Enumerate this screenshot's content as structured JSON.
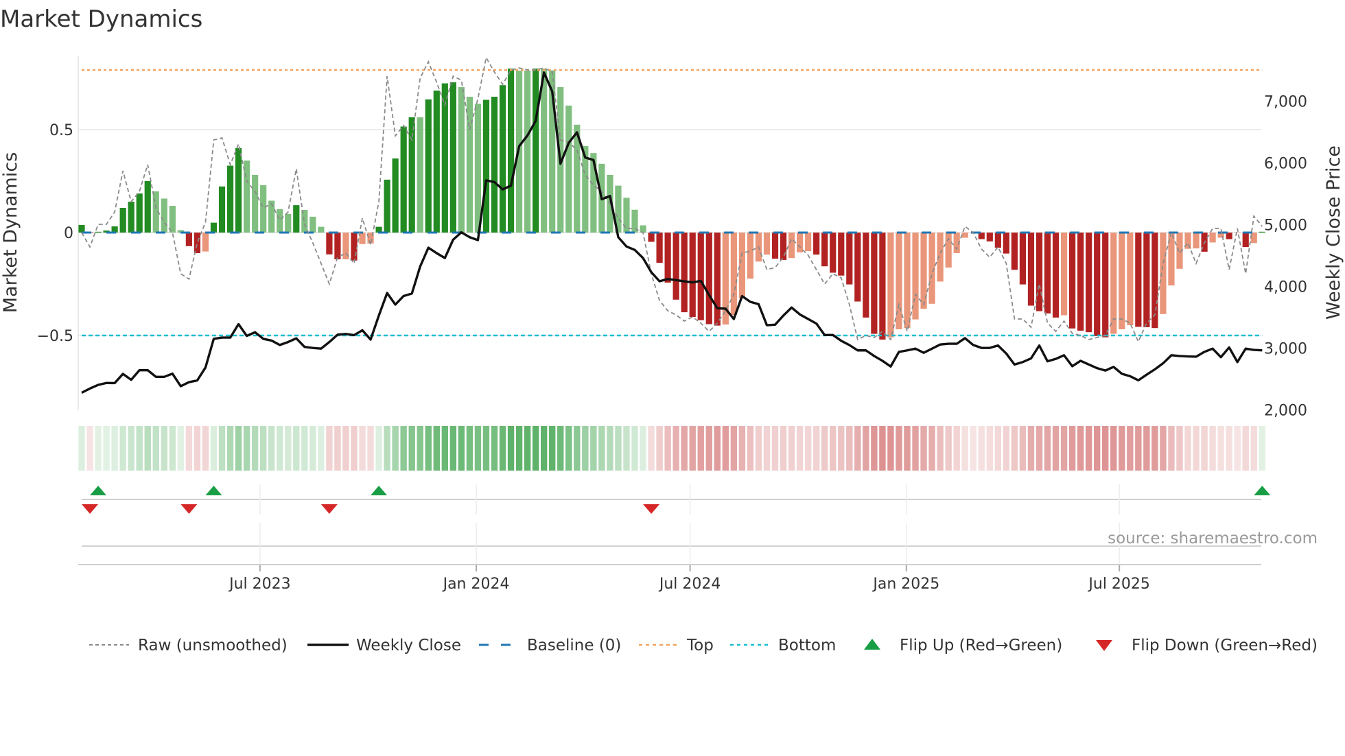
{
  "title": "Market Dynamics",
  "source": "source: sharemaestro.com",
  "chart_data": {
    "type": "bar",
    "title": "Market Dynamics",
    "left_axis": {
      "label": "Market Dynamics",
      "range": [
        -0.86,
        0.86
      ],
      "ticks": [
        {
          "v": 0.5,
          "label": "0.5"
        },
        {
          "v": 0,
          "label": "0"
        },
        {
          "v": -0.5,
          "label": "−0.5"
        }
      ]
    },
    "right_axis": {
      "label": "Weekly Close Price",
      "range": [
        2000,
        7740
      ],
      "ticks": [
        {
          "v": 2000,
          "label": "2,000"
        },
        {
          "v": 3000,
          "label": "3,000"
        },
        {
          "v": 4000,
          "label": "4,000"
        },
        {
          "v": 5000,
          "label": "5,000"
        },
        {
          "v": 6000,
          "label": "6,000"
        },
        {
          "v": 7000,
          "label": "7,000"
        }
      ]
    },
    "x_unit": "week index",
    "x_ticks": [
      {
        "week": 21.6,
        "label": "Jul 2023"
      },
      {
        "week": 47.8,
        "label": "Jan 2024"
      },
      {
        "week": 73.7,
        "label": "Jul 2024"
      },
      {
        "week": 99.9,
        "label": "Jan 2025"
      },
      {
        "week": 125.7,
        "label": "Jul 2025"
      }
    ],
    "baseline": 0,
    "top_level": 0.79,
    "bottom_level": -0.5,
    "dynamics": [
      0.037,
      -0.003,
      0.004,
      0.01,
      0.03,
      0.12,
      0.15,
      0.19,
      0.25,
      0.2,
      0.165,
      0.13,
      0.012,
      -0.066,
      -0.1,
      -0.092,
      0.048,
      0.224,
      0.325,
      0.41,
      0.35,
      0.28,
      0.23,
      0.155,
      0.114,
      0.09,
      0.133,
      0.11,
      0.077,
      0.028,
      -0.106,
      -0.13,
      -0.13,
      -0.136,
      -0.056,
      -0.053,
      0.028,
      0.257,
      0.36,
      0.515,
      0.56,
      0.56,
      0.647,
      0.69,
      0.725,
      0.73,
      0.707,
      0.66,
      0.626,
      0.645,
      0.66,
      0.716,
      0.797,
      0.787,
      0.787,
      0.797,
      0.797,
      0.788,
      0.707,
      0.617,
      0.524,
      0.42,
      0.386,
      0.334,
      0.28,
      0.228,
      0.169,
      0.111,
      0.035,
      -0.045,
      -0.147,
      -0.243,
      -0.326,
      -0.387,
      -0.41,
      -0.426,
      -0.445,
      -0.452,
      -0.447,
      -0.4,
      -0.32,
      -0.224,
      -0.141,
      -0.107,
      -0.127,
      -0.133,
      -0.124,
      -0.096,
      -0.09,
      -0.107,
      -0.164,
      -0.195,
      -0.209,
      -0.252,
      -0.335,
      -0.413,
      -0.492,
      -0.52,
      -0.509,
      -0.47,
      -0.464,
      -0.422,
      -0.37,
      -0.346,
      -0.238,
      -0.17,
      -0.1,
      -0.025,
      -0.002,
      -0.032,
      -0.043,
      -0.074,
      -0.102,
      -0.181,
      -0.252,
      -0.355,
      -0.382,
      -0.393,
      -0.413,
      -0.402,
      -0.466,
      -0.477,
      -0.484,
      -0.503,
      -0.509,
      -0.492,
      -0.47,
      -0.45,
      -0.458,
      -0.46,
      -0.464,
      -0.396,
      -0.257,
      -0.176,
      -0.079,
      -0.077,
      -0.093,
      -0.048,
      -0.025,
      -0.032,
      -0.002,
      -0.07,
      -0.051,
      0.004
    ],
    "raw": [
      0.0,
      -0.07,
      0.04,
      0.04,
      0.1,
      0.3,
      0.15,
      0.2,
      0.33,
      0.12,
      0.05,
      0.0,
      -0.2,
      -0.226,
      -0.05,
      0.05,
      0.45,
      0.46,
      0.33,
      0.43,
      0.25,
      0.2,
      0.12,
      0.14,
      0.06,
      0.1,
      0.31,
      0.04,
      -0.05,
      -0.15,
      -0.25,
      -0.12,
      -0.1,
      -0.15,
      0.07,
      -0.06,
      0.15,
      0.76,
      0.47,
      0.52,
      0.45,
      0.75,
      0.83,
      0.73,
      0.62,
      0.76,
      0.74,
      0.5,
      0.65,
      0.85,
      0.78,
      0.72,
      0.79,
      0.8,
      0.79,
      0.79,
      0.8,
      0.78,
      0.45,
      0.44,
      0.4,
      0.28,
      0.23,
      0.2,
      0.14,
      0.07,
      0.02,
      0.02,
      0.0,
      -0.2,
      -0.33,
      -0.38,
      -0.4,
      -0.43,
      -0.41,
      -0.44,
      -0.48,
      -0.44,
      -0.38,
      -0.3,
      -0.1,
      -0.09,
      -0.07,
      -0.18,
      -0.17,
      -0.12,
      -0.03,
      -0.07,
      -0.11,
      -0.18,
      -0.25,
      -0.2,
      -0.22,
      -0.35,
      -0.52,
      -0.5,
      -0.51,
      -0.48,
      -0.52,
      -0.35,
      -0.48,
      -0.3,
      -0.35,
      -0.2,
      -0.1,
      -0.03,
      -0.08,
      0.03,
      0.0,
      -0.08,
      -0.12,
      -0.07,
      -0.15,
      -0.42,
      -0.42,
      -0.46,
      -0.25,
      -0.44,
      -0.48,
      -0.43,
      -0.49,
      -0.5,
      -0.52,
      -0.51,
      -0.5,
      -0.42,
      -0.42,
      -0.44,
      -0.53,
      -0.44,
      -0.4,
      -0.15,
      0.0,
      -0.1,
      -0.05,
      -0.15,
      -0.05,
      0.02,
      0.02,
      -0.18,
      0.02,
      -0.2,
      0.08,
      0.03
    ],
    "close": [
      2278,
      2346,
      2405,
      2436,
      2434,
      2583,
      2488,
      2643,
      2643,
      2535,
      2535,
      2587,
      2384,
      2449,
      2477,
      2687,
      3151,
      3171,
      3171,
      3389,
      3199,
      3258,
      3151,
      3123,
      3051,
      3099,
      3159,
      3020,
      3004,
      2992,
      3099,
      3218,
      3230,
      3210,
      3290,
      3139,
      3528,
      3893,
      3706,
      3845,
      3885,
      4321,
      4627,
      4539,
      4460,
      4757,
      4876,
      4797,
      4750,
      5718,
      5690,
      5571,
      5631,
      6273,
      6444,
      6683,
      7464,
      7159,
      5988,
      6325,
      6495,
      6087,
      6047,
      5412,
      5464,
      4797,
      4646,
      4591,
      4460,
      4231,
      4083,
      4120,
      4102,
      4083,
      4065,
      4090,
      3861,
      3646,
      3639,
      3472,
      3843,
      3750,
      3713,
      3372,
      3380,
      3528,
      3658,
      3546,
      3472,
      3398,
      3213,
      3213,
      3120,
      3050,
      2964,
      2964,
      2873,
      2795,
      2703,
      2940,
      2964,
      2992,
      2925,
      2992,
      3059,
      3071,
      3071,
      3162,
      3051,
      3004,
      3004,
      3043,
      2913,
      2735,
      2775,
      2834,
      3043,
      2787,
      2826,
      2885,
      2707,
      2795,
      2735,
      2676,
      2637,
      2696,
      2585,
      2546,
      2479,
      2570,
      2657,
      2755,
      2885,
      2873,
      2866,
      2862,
      2940,
      2992,
      2854,
      3012,
      2775,
      2992,
      2972,
      2964
    ],
    "flip_up_weeks": [
      2,
      16,
      36,
      143
    ],
    "flip_down_weeks": [
      1,
      13,
      30,
      69
    ],
    "legend_position": "bottom",
    "legend": [
      {
        "key": "raw",
        "label": "Raw (unsmoothed)"
      },
      {
        "key": "close",
        "label": "Weekly Close"
      },
      {
        "key": "baseline",
        "label": "Baseline (0)"
      },
      {
        "key": "top",
        "label": "Top"
      },
      {
        "key": "bottom",
        "label": "Bottom"
      },
      {
        "key": "flip_up",
        "label": "Flip Up (Red→Green)"
      },
      {
        "key": "flip_down",
        "label": "Flip Down (Green→Red)"
      }
    ],
    "colors": {
      "pos_strong": "#228b22",
      "pos_weak": "#80bf80",
      "neg_strong": "#b22222",
      "neg_weak": "#e9967a",
      "raw": "#8a8a8a",
      "close": "#111111",
      "baseline": "#1f77b4",
      "top": "#f4a460",
      "bottom": "#17becf",
      "flip_up": "#1a9e45",
      "flip_down": "#d62728"
    }
  }
}
